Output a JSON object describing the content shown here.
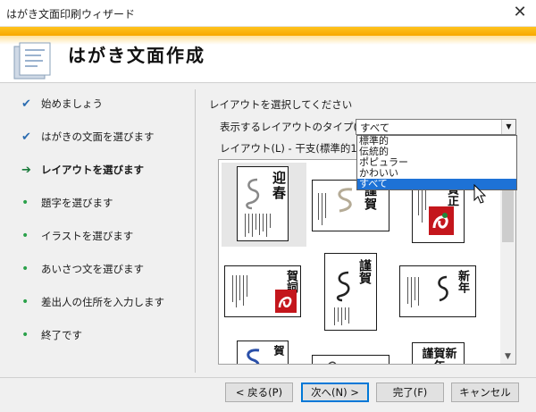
{
  "window": {
    "title": "はがき文面印刷ウィザード",
    "close_glyph": "✕"
  },
  "header": {
    "title": "はがき文面作成"
  },
  "steps": [
    {
      "label": "始めましょう",
      "state": "done"
    },
    {
      "label": "はがきの文面を選びます",
      "state": "done"
    },
    {
      "label": "レイアウトを選びます",
      "state": "current"
    },
    {
      "label": "題字を選びます",
      "state": "todo"
    },
    {
      "label": "イラストを選びます",
      "state": "todo"
    },
    {
      "label": "あいさつ文を選びます",
      "state": "todo"
    },
    {
      "label": "差出人の住所を入力します",
      "state": "todo"
    },
    {
      "label": "終了です",
      "state": "todo"
    }
  ],
  "main": {
    "prompt": "レイアウトを選択してください",
    "type_label": "表示するレイアウトのタイプ(T):",
    "type_value": "すべて",
    "type_options": [
      "標準的",
      "伝統的",
      "ポピュラー",
      "かわいい",
      "すべて"
    ],
    "type_selected_index": 4,
    "layout_label": "レイアウト(L) - 干支(標準的1)",
    "thumbnails": [
      {
        "glyph": "迎春"
      },
      {
        "glyph": "謹賀"
      },
      {
        "glyph": "賀正"
      },
      {
        "glyph": "賀詞"
      },
      {
        "glyph": "謹賀"
      },
      {
        "glyph": "新年"
      },
      {
        "glyph": "賀"
      },
      {
        "glyph": ""
      },
      {
        "glyph": "謹賀新年"
      }
    ]
  },
  "buttons": {
    "back": "< 戻る(P)",
    "next": "次へ(N) >",
    "finish": "完了(F)",
    "cancel": "キャンセル"
  },
  "colors": {
    "accent": "#f7a800",
    "selection": "#1e72d6",
    "check": "#2b6cb0",
    "bullet": "#2aa14a"
  }
}
